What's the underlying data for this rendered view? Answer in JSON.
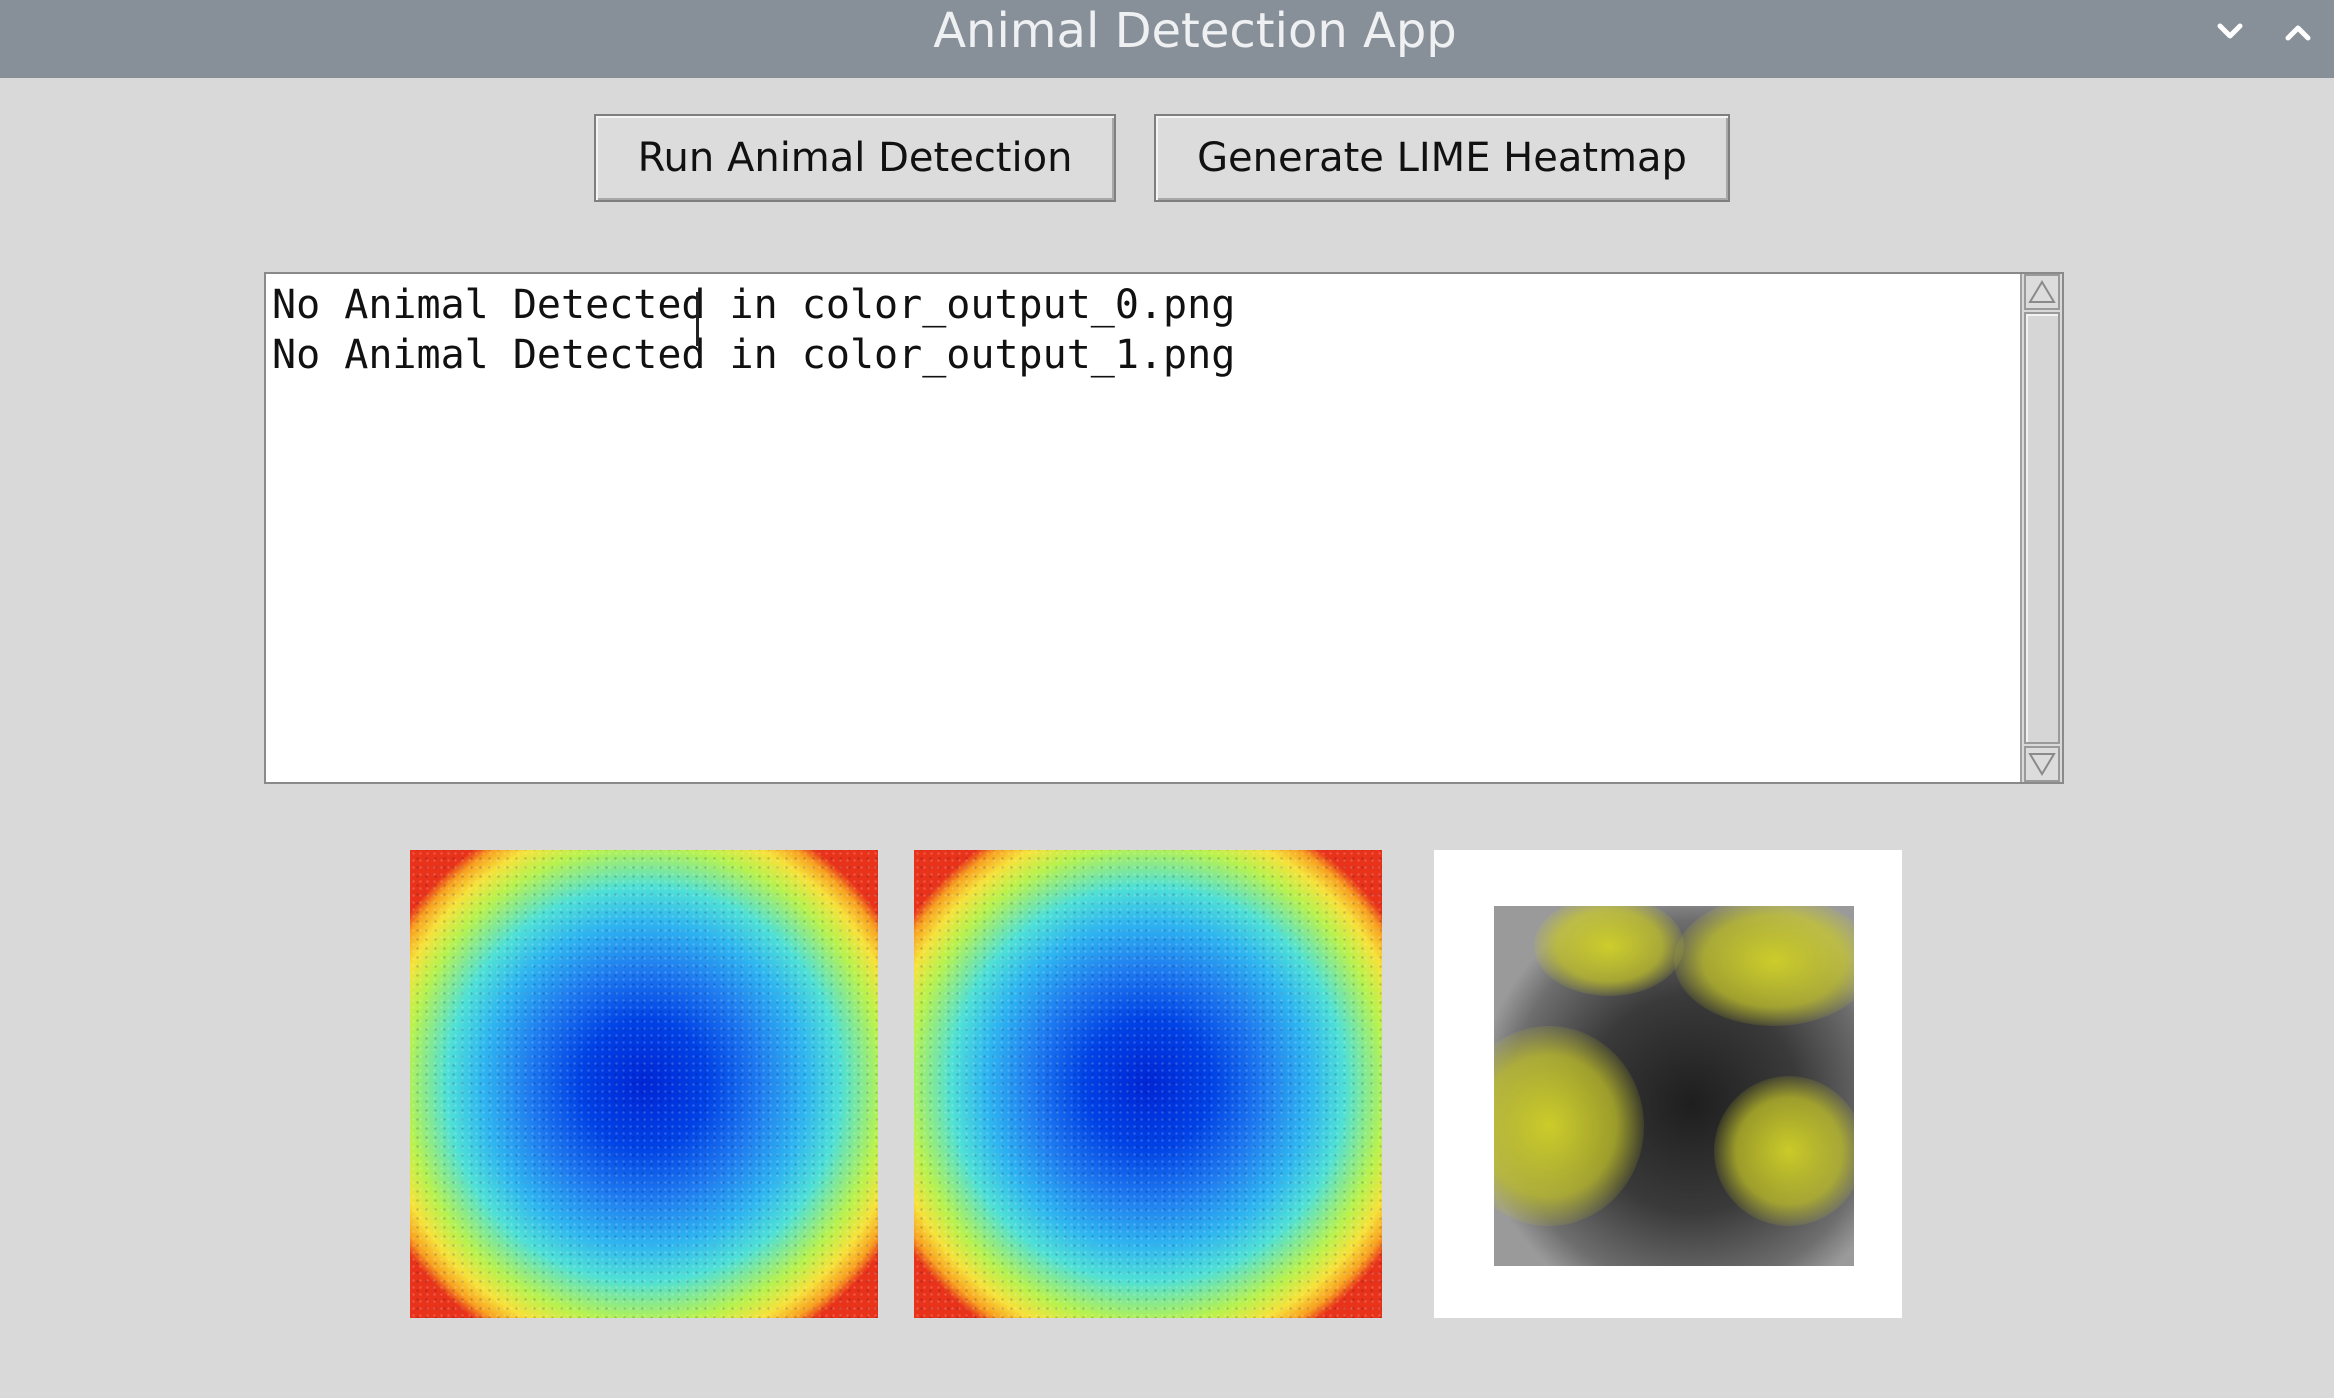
{
  "window": {
    "title": "Animal Detection App"
  },
  "toolbar": {
    "run_label": "Run Animal Detection",
    "lime_label": "Generate LIME Heatmap"
  },
  "log": {
    "lines": [
      "No Animal Detected in color_output_0.png",
      "No Animal Detected in color_output_1.png"
    ]
  },
  "images": [
    {
      "name": "color_output_0 heatmap",
      "kind": "jet-heatmap"
    },
    {
      "name": "color_output_1 heatmap",
      "kind": "jet-heatmap"
    },
    {
      "name": "LIME explanation",
      "kind": "lime-overlay"
    }
  ],
  "colors": {
    "titlebar": "#878f99",
    "window_bg": "#d9d9d9",
    "lime_highlight": "#c8c830"
  },
  "icons": {
    "minimize": "chevron-down-icon",
    "maximize": "chevron-up-icon",
    "scroll_up": "triangle-up-icon",
    "scroll_down": "triangle-down-icon"
  }
}
